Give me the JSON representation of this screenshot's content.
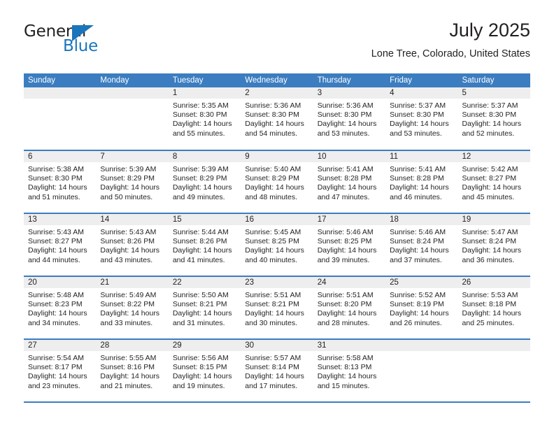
{
  "logo": {
    "word_top": "General",
    "word_bottom": "Blue",
    "triangle_color": "#1b75bb",
    "icon": "triangle-icon"
  },
  "header": {
    "title": "July 2025",
    "subtitle": "Lone Tree, Colorado, United States"
  },
  "theme": {
    "header_blue": "#3b7dc0",
    "daynum_gray": "#eeeeee",
    "text": "#231f20"
  },
  "calendar": {
    "weekday_headers": [
      "Sunday",
      "Monday",
      "Tuesday",
      "Wednesday",
      "Thursday",
      "Friday",
      "Saturday"
    ],
    "weeks": [
      [
        {
          "day": "",
          "lines": []
        },
        {
          "day": "",
          "lines": []
        },
        {
          "day": "1",
          "lines": [
            "Sunrise: 5:35 AM",
            "Sunset: 8:30 PM",
            "Daylight: 14 hours",
            "and 55 minutes."
          ]
        },
        {
          "day": "2",
          "lines": [
            "Sunrise: 5:36 AM",
            "Sunset: 8:30 PM",
            "Daylight: 14 hours",
            "and 54 minutes."
          ]
        },
        {
          "day": "3",
          "lines": [
            "Sunrise: 5:36 AM",
            "Sunset: 8:30 PM",
            "Daylight: 14 hours",
            "and 53 minutes."
          ]
        },
        {
          "day": "4",
          "lines": [
            "Sunrise: 5:37 AM",
            "Sunset: 8:30 PM",
            "Daylight: 14 hours",
            "and 53 minutes."
          ]
        },
        {
          "day": "5",
          "lines": [
            "Sunrise: 5:37 AM",
            "Sunset: 8:30 PM",
            "Daylight: 14 hours",
            "and 52 minutes."
          ]
        }
      ],
      [
        {
          "day": "6",
          "lines": [
            "Sunrise: 5:38 AM",
            "Sunset: 8:30 PM",
            "Daylight: 14 hours",
            "and 51 minutes."
          ]
        },
        {
          "day": "7",
          "lines": [
            "Sunrise: 5:39 AM",
            "Sunset: 8:29 PM",
            "Daylight: 14 hours",
            "and 50 minutes."
          ]
        },
        {
          "day": "8",
          "lines": [
            "Sunrise: 5:39 AM",
            "Sunset: 8:29 PM",
            "Daylight: 14 hours",
            "and 49 minutes."
          ]
        },
        {
          "day": "9",
          "lines": [
            "Sunrise: 5:40 AM",
            "Sunset: 8:29 PM",
            "Daylight: 14 hours",
            "and 48 minutes."
          ]
        },
        {
          "day": "10",
          "lines": [
            "Sunrise: 5:41 AM",
            "Sunset: 8:28 PM",
            "Daylight: 14 hours",
            "and 47 minutes."
          ]
        },
        {
          "day": "11",
          "lines": [
            "Sunrise: 5:41 AM",
            "Sunset: 8:28 PM",
            "Daylight: 14 hours",
            "and 46 minutes."
          ]
        },
        {
          "day": "12",
          "lines": [
            "Sunrise: 5:42 AM",
            "Sunset: 8:27 PM",
            "Daylight: 14 hours",
            "and 45 minutes."
          ]
        }
      ],
      [
        {
          "day": "13",
          "lines": [
            "Sunrise: 5:43 AM",
            "Sunset: 8:27 PM",
            "Daylight: 14 hours",
            "and 44 minutes."
          ]
        },
        {
          "day": "14",
          "lines": [
            "Sunrise: 5:43 AM",
            "Sunset: 8:26 PM",
            "Daylight: 14 hours",
            "and 43 minutes."
          ]
        },
        {
          "day": "15",
          "lines": [
            "Sunrise: 5:44 AM",
            "Sunset: 8:26 PM",
            "Daylight: 14 hours",
            "and 41 minutes."
          ]
        },
        {
          "day": "16",
          "lines": [
            "Sunrise: 5:45 AM",
            "Sunset: 8:25 PM",
            "Daylight: 14 hours",
            "and 40 minutes."
          ]
        },
        {
          "day": "17",
          "lines": [
            "Sunrise: 5:46 AM",
            "Sunset: 8:25 PM",
            "Daylight: 14 hours",
            "and 39 minutes."
          ]
        },
        {
          "day": "18",
          "lines": [
            "Sunrise: 5:46 AM",
            "Sunset: 8:24 PM",
            "Daylight: 14 hours",
            "and 37 minutes."
          ]
        },
        {
          "day": "19",
          "lines": [
            "Sunrise: 5:47 AM",
            "Sunset: 8:24 PM",
            "Daylight: 14 hours",
            "and 36 minutes."
          ]
        }
      ],
      [
        {
          "day": "20",
          "lines": [
            "Sunrise: 5:48 AM",
            "Sunset: 8:23 PM",
            "Daylight: 14 hours",
            "and 34 minutes."
          ]
        },
        {
          "day": "21",
          "lines": [
            "Sunrise: 5:49 AM",
            "Sunset: 8:22 PM",
            "Daylight: 14 hours",
            "and 33 minutes."
          ]
        },
        {
          "day": "22",
          "lines": [
            "Sunrise: 5:50 AM",
            "Sunset: 8:21 PM",
            "Daylight: 14 hours",
            "and 31 minutes."
          ]
        },
        {
          "day": "23",
          "lines": [
            "Sunrise: 5:51 AM",
            "Sunset: 8:21 PM",
            "Daylight: 14 hours",
            "and 30 minutes."
          ]
        },
        {
          "day": "24",
          "lines": [
            "Sunrise: 5:51 AM",
            "Sunset: 8:20 PM",
            "Daylight: 14 hours",
            "and 28 minutes."
          ]
        },
        {
          "day": "25",
          "lines": [
            "Sunrise: 5:52 AM",
            "Sunset: 8:19 PM",
            "Daylight: 14 hours",
            "and 26 minutes."
          ]
        },
        {
          "day": "26",
          "lines": [
            "Sunrise: 5:53 AM",
            "Sunset: 8:18 PM",
            "Daylight: 14 hours",
            "and 25 minutes."
          ]
        }
      ],
      [
        {
          "day": "27",
          "lines": [
            "Sunrise: 5:54 AM",
            "Sunset: 8:17 PM",
            "Daylight: 14 hours",
            "and 23 minutes."
          ]
        },
        {
          "day": "28",
          "lines": [
            "Sunrise: 5:55 AM",
            "Sunset: 8:16 PM",
            "Daylight: 14 hours",
            "and 21 minutes."
          ]
        },
        {
          "day": "29",
          "lines": [
            "Sunrise: 5:56 AM",
            "Sunset: 8:15 PM",
            "Daylight: 14 hours",
            "and 19 minutes."
          ]
        },
        {
          "day": "30",
          "lines": [
            "Sunrise: 5:57 AM",
            "Sunset: 8:14 PM",
            "Daylight: 14 hours",
            "and 17 minutes."
          ]
        },
        {
          "day": "31",
          "lines": [
            "Sunrise: 5:58 AM",
            "Sunset: 8:13 PM",
            "Daylight: 14 hours",
            "and 15 minutes."
          ]
        },
        {
          "day": "",
          "lines": []
        },
        {
          "day": "",
          "lines": []
        }
      ]
    ]
  }
}
